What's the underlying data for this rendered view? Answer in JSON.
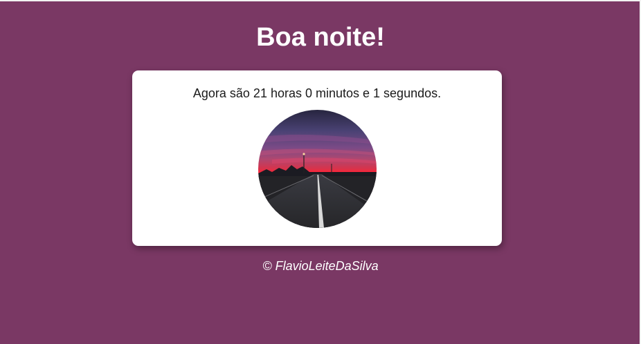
{
  "greeting": "Boa noite!",
  "time_message": "Agora são 21 horas 0 minutos e 1 segundos.",
  "image": {
    "subject": "road at night under a purple and red sunset sky"
  },
  "footer": "© FlavioLeiteDaSilva",
  "colors": {
    "background": "#7a3864",
    "card": "#ffffff",
    "heading_text": "#ffffff",
    "body_text": "#1a1a1a"
  }
}
